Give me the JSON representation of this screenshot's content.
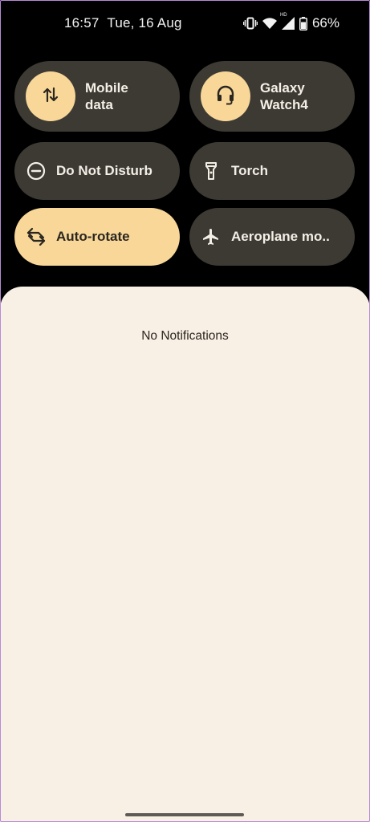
{
  "status_bar": {
    "time": "16:57",
    "date": "Tue, 16 Aug",
    "battery": "66%",
    "hd_label": "HD",
    "icons": [
      "vibrate-icon",
      "wifi-icon",
      "hd-voice-icon",
      "cell-signal-icon",
      "battery-icon"
    ]
  },
  "tiles": {
    "mobile_data": {
      "label": "Mobile data",
      "line1": "Mobile",
      "line2": "data",
      "icon": "mobile-data-arrows-icon",
      "active": false
    },
    "galaxy_watch": {
      "label": "Galaxy Watch4",
      "line1": "Galaxy",
      "line2": "Watch4",
      "icon": "headset-icon",
      "active": false
    },
    "dnd": {
      "label": "Do Not Disturb",
      "icon": "do-not-disturb-icon",
      "active": false
    },
    "torch": {
      "label": "Torch",
      "icon": "flashlight-icon",
      "active": false
    },
    "auto_rotate": {
      "label": "Auto-rotate",
      "icon": "auto-rotate-icon",
      "active": true
    },
    "aeroplane": {
      "label": "Aeroplane mo..",
      "icon": "airplane-icon",
      "active": false
    }
  },
  "notifications": {
    "empty_text": "No Notifications"
  },
  "colors": {
    "background": "#000000",
    "tile_inactive": "#3d3a34",
    "tile_active": "#f8d798",
    "sheet": "#f8efe5",
    "text_light": "#f4efe6",
    "text_dark": "#2b2620"
  }
}
